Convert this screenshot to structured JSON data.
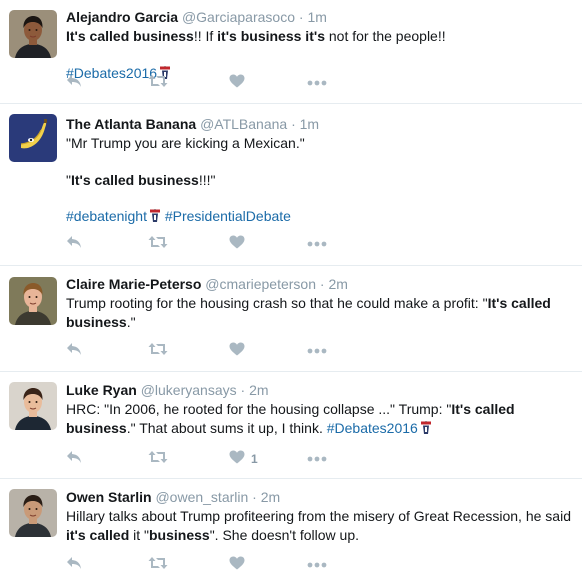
{
  "tweets": [
    {
      "name": "Alejandro Garcia",
      "handle": "@Garciaparasoco",
      "time": "1m",
      "paragraphs": [
        [
          {
            "t": "It's called business",
            "b": true
          },
          {
            "t": "!! If "
          },
          {
            "t": "it's business it's",
            "b": true
          },
          {
            "t": " not for the people!!"
          }
        ],
        [
          {
            "t": "#Debates2016",
            "tag": true
          },
          {
            "icon": "debate-podium-emoji"
          }
        ]
      ],
      "likes": "",
      "avatar": {
        "bg": "#9b8f7a",
        "skin": "#8d5a3b",
        "hair": "#1c1612",
        "shirt": "#1f2126"
      }
    },
    {
      "name": "The Atlanta Banana",
      "handle": "@ATLBanana",
      "time": "1m",
      "paragraphs": [
        [
          {
            "t": "\"Mr Trump you are kicking a Mexican.\""
          }
        ],
        [
          {
            "t": "\""
          },
          {
            "t": "It's called business",
            "b": true
          },
          {
            "t": "!!!\""
          }
        ],
        [
          {
            "t": "#debatenight",
            "tag": true
          },
          {
            "icon": "debate-podium-emoji"
          },
          {
            "t": " "
          },
          {
            "t": "#PresidentialDebate",
            "tag": true
          }
        ]
      ],
      "likes": "",
      "avatar": {
        "bg": "#2a3a7a",
        "logo": "banana"
      }
    },
    {
      "name": "Claire Marie-Peterso",
      "handle": "@cmariepeterson",
      "time": "2m",
      "paragraphs": [
        [
          {
            "t": "Trump rooting for the housing crash so that he could make a profit: \""
          },
          {
            "t": "It's called business",
            "b": true
          },
          {
            "t": ".\""
          }
        ]
      ],
      "likes": "",
      "avatar": {
        "bg": "#7f7a5a",
        "skin": "#e8b598",
        "hair": "#8a5a2a",
        "shirt": "#3c3a30"
      }
    },
    {
      "name": "Luke Ryan",
      "handle": "@lukeryansays",
      "time": "2m",
      "paragraphs": [
        [
          {
            "t": "HRC: \"In 2006, he rooted for the housing collapse ...\" Trump: \""
          },
          {
            "t": "It's called business",
            "b": true
          },
          {
            "t": ".\" That about sums it up, I think. "
          },
          {
            "t": "#Debates2016",
            "tag": true
          },
          {
            "icon": "debate-podium-emoji"
          }
        ]
      ],
      "likes": "1",
      "avatar": {
        "bg": "#d9d4cc",
        "skin": "#e9bc9b",
        "hair": "#3a2418",
        "shirt": "#1d2733"
      }
    },
    {
      "name": "Owen Starlin",
      "handle": "@owen_starlin",
      "time": "2m",
      "paragraphs": [
        [
          {
            "t": "Hillary talks about Trump profiteering from the misery of Great Recession, he said "
          },
          {
            "t": "it's called",
            "b": true
          },
          {
            "t": " it \""
          },
          {
            "t": "business",
            "b": true
          },
          {
            "t": "\".  She doesn't follow up."
          }
        ]
      ],
      "likes": "",
      "avatar": {
        "bg": "#b8b2a8",
        "skin": "#c99a78",
        "hair": "#2a1e16",
        "shirt": "#2c3136"
      }
    }
  ],
  "ui": {
    "separator": " · ",
    "icons": {
      "reply": "reply-icon",
      "retweet": "retweet-icon",
      "like": "heart-icon",
      "more": "more-dots-icon"
    },
    "colors": {
      "name": "#14171a",
      "meta": "#8899a6",
      "hashtag": "#1b6ba8",
      "action_icon": "#aab8c2",
      "divider": "#e6ecf0"
    }
  }
}
